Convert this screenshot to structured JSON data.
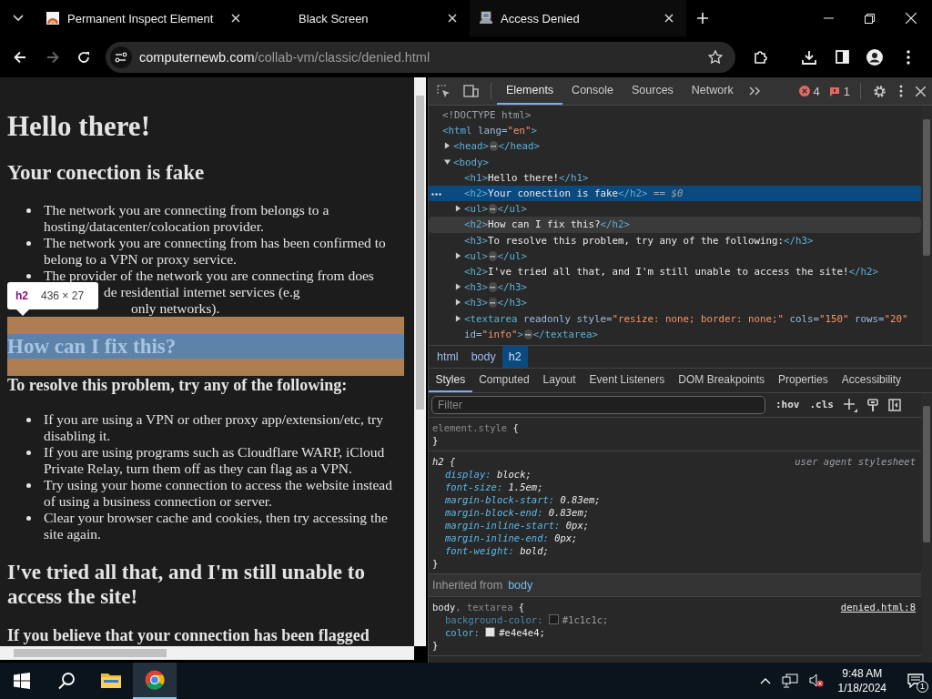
{
  "browser": {
    "tabs": [
      {
        "title": "Permanent Inspect Element",
        "kind": "image",
        "selected": false
      },
      {
        "title": "Black Screen",
        "kind": "blank",
        "selected": false
      },
      {
        "title": "Access Denied",
        "kind": "computer",
        "selected": true
      }
    ],
    "forward_disabled": true,
    "url": {
      "host": "computernewb.com",
      "path": "/collab-vm/classic/denied.html"
    }
  },
  "page": {
    "blocks": [
      {
        "kind": "h1",
        "text": "Hello there!",
        "highlighted": false
      },
      {
        "kind": "h2",
        "text": "Your conection is fake",
        "highlighted": false
      },
      {
        "kind": "ul",
        "items": [
          {
            "text": "The network you are connecting from belongs to a hosting/datacenter/colocation provider."
          },
          {
            "text": "The network you are connecting from has been confirmed to belong to a VPN or proxy service."
          },
          {
            "lines": [
              "The provider of the network you are connecting from does",
              "de residential internet services (e.g",
              "only networks)."
            ]
          }
        ]
      },
      {
        "kind": "h2",
        "text": "How can I fix this?",
        "highlighted": true
      },
      {
        "kind": "h3",
        "text": "To resolve this problem, try any of the following:",
        "highlighted": false
      },
      {
        "kind": "ul",
        "items": [
          {
            "text": "If you are using a VPN or other proxy app/extension/etc, try disabling it."
          },
          {
            "text": "If you are using programs such as Cloudflare WARP, iCloud Private Relay, turn them off as they can flag as a VPN."
          },
          {
            "text": "Try using your home connection to access the website instead of using a business connection or server."
          },
          {
            "text": "Clear your browser cache and cookies, then try accessing the site again."
          }
        ]
      },
      {
        "kind": "h2",
        "text": "I've tried all that, and I'm still unable to access the site!",
        "highlighted": false
      },
      {
        "kind": "h3",
        "text": "If you believe that your connection has been flagged",
        "highlighted": false
      }
    ],
    "tooltip": {
      "tag": "h2",
      "size": "436 × 27"
    }
  },
  "devtools": {
    "tabs": [
      {
        "label": "Elements",
        "selected": true
      },
      {
        "label": "Console",
        "selected": false
      },
      {
        "label": "Sources",
        "selected": false
      },
      {
        "label": "Network",
        "selected": false
      }
    ],
    "errors": "4",
    "issues": "1",
    "dom": [
      {
        "selected": false,
        "hovered": false,
        "tokens": [
          {
            "kind": "dim",
            "text": "<!DOCTYPE html>"
          }
        ]
      },
      {
        "selected": false,
        "hovered": false,
        "tokens": [
          {
            "kind": "tag",
            "text": "<html "
          },
          {
            "kind": "attr",
            "text": "lang="
          },
          {
            "kind": "value",
            "text": "\"en\""
          },
          {
            "kind": "tag",
            "text": ">"
          }
        ],
        "children": [
          {
            "selected": false,
            "hovered": false,
            "expanded": false,
            "tokens": [
              {
                "kind": "tag",
                "text": "<head>"
              },
              {
                "kind": "more",
                "text": "⋯"
              },
              {
                "kind": "tag",
                "text": "</head>"
              }
            ]
          },
          {
            "selected": false,
            "hovered": false,
            "expanded": true,
            "tokens": [
              {
                "kind": "tag",
                "text": "<body>"
              }
            ],
            "children": [
              {
                "selected": false,
                "hovered": false,
                "tokens": [
                  {
                    "kind": "tag",
                    "text": "<h1>"
                  },
                  {
                    "kind": "text",
                    "text": "Hello there!"
                  },
                  {
                    "kind": "tag",
                    "text": "</h1>"
                  }
                ]
              },
              {
                "selected": true,
                "hovered": false,
                "tokens": [
                  {
                    "kind": "tag",
                    "text": "<h2>"
                  },
                  {
                    "kind": "text",
                    "text": "Your conection is fake"
                  },
                  {
                    "kind": "tag",
                    "text": "</h2>"
                  },
                  {
                    "kind": "ref",
                    "text": " == $0"
                  }
                ]
              },
              {
                "selected": false,
                "hovered": false,
                "expanded": false,
                "tokens": [
                  {
                    "kind": "tag",
                    "text": "<ul>"
                  },
                  {
                    "kind": "more",
                    "text": "⋯"
                  },
                  {
                    "kind": "tag",
                    "text": "</ul>"
                  }
                ]
              },
              {
                "selected": false,
                "hovered": true,
                "tokens": [
                  {
                    "kind": "tag",
                    "text": "<h2>"
                  },
                  {
                    "kind": "text",
                    "text": "How can I fix this?"
                  },
                  {
                    "kind": "tag",
                    "text": "</h2>"
                  }
                ]
              },
              {
                "selected": false,
                "hovered": false,
                "tokens": [
                  {
                    "kind": "tag",
                    "text": "<h3>"
                  },
                  {
                    "kind": "text",
                    "text": "To resolve this problem, try any of the following:"
                  },
                  {
                    "kind": "tag",
                    "text": "</h3>"
                  }
                ]
              },
              {
                "selected": false,
                "hovered": false,
                "expanded": false,
                "tokens": [
                  {
                    "kind": "tag",
                    "text": "<ul>"
                  },
                  {
                    "kind": "more",
                    "text": "⋯"
                  },
                  {
                    "kind": "tag",
                    "text": "</ul>"
                  }
                ]
              },
              {
                "selected": false,
                "hovered": false,
                "tokens": [
                  {
                    "kind": "tag",
                    "text": "<h2>"
                  },
                  {
                    "kind": "text",
                    "text": "I've tried all that, and I'm still unable to access the site!"
                  },
                  {
                    "kind": "tag",
                    "text": "</h2>"
                  }
                ]
              },
              {
                "selected": false,
                "hovered": false,
                "expanded": false,
                "tokens": [
                  {
                    "kind": "tag",
                    "text": "<h3>"
                  },
                  {
                    "kind": "more",
                    "text": "⋯"
                  },
                  {
                    "kind": "tag",
                    "text": "</h3>"
                  }
                ]
              },
              {
                "selected": false,
                "hovered": false,
                "expanded": false,
                "tokens": [
                  {
                    "kind": "tag",
                    "text": "<h3>"
                  },
                  {
                    "kind": "more",
                    "text": "⋯"
                  },
                  {
                    "kind": "tag",
                    "text": "</h3>"
                  }
                ]
              },
              {
                "selected": false,
                "hovered": false,
                "expanded": false,
                "tokens": [
                  {
                    "kind": "tag",
                    "text": "<textarea "
                  },
                  {
                    "kind": "attr",
                    "text": "readonly style="
                  },
                  {
                    "kind": "value",
                    "text": "\"resize: none; border: none;\""
                  },
                  {
                    "kind": "attr",
                    "text": " cols="
                  },
                  {
                    "kind": "value",
                    "text": "\"150\""
                  },
                  {
                    "kind": "attr",
                    "text": " rows="
                  },
                  {
                    "kind": "value",
                    "text": "\"20\""
                  },
                  {
                    "kind": "attr",
                    "text": " id="
                  },
                  {
                    "kind": "value",
                    "text": "\"info\""
                  },
                  {
                    "kind": "tag",
                    "text": ">"
                  },
                  {
                    "kind": "more",
                    "text": "⋯"
                  },
                  {
                    "kind": "tag",
                    "text": "</textarea>"
                  }
                ]
              }
            ]
          }
        ]
      }
    ],
    "breadcrumbs": [
      {
        "label": "html",
        "selected": false
      },
      {
        "label": "body",
        "selected": false
      },
      {
        "label": "h2",
        "selected": true
      }
    ],
    "panes": [
      {
        "label": "Styles",
        "selected": true
      },
      {
        "label": "Computed",
        "selected": false
      },
      {
        "label": "Layout",
        "selected": false
      },
      {
        "label": "Event Listeners",
        "selected": false
      },
      {
        "label": "DOM Breakpoints",
        "selected": false
      },
      {
        "label": "Properties",
        "selected": false
      },
      {
        "label": "Accessibility",
        "selected": false
      }
    ],
    "filter": {
      "placeholder": "Filter"
    },
    "hov": ":hov",
    "cls": ".cls",
    "rules": [
      {
        "kind": "rule",
        "italic": false,
        "selector": [
          {
            "kind": "dim",
            "text": "element.style"
          },
          {
            "kind": "punc",
            "text": " {"
          }
        ],
        "close": "}"
      },
      {
        "kind": "rule",
        "italic": true,
        "selector": [
          {
            "kind": "sel",
            "text": "h2"
          },
          {
            "kind": "punc",
            "text": " {"
          }
        ],
        "source": "user agent stylesheet",
        "props": [
          {
            "name": "display:",
            "value": "block;",
            "inactive": false
          },
          {
            "name": "font-size:",
            "value": "1.5em;",
            "inactive": false
          },
          {
            "name": "margin-block-start:",
            "value": "0.83em;",
            "inactive": false
          },
          {
            "name": "margin-block-end:",
            "value": "0.83em;",
            "inactive": false
          },
          {
            "name": "margin-inline-start:",
            "value": "0px;",
            "inactive": false
          },
          {
            "name": "margin-inline-end:",
            "value": "0px;",
            "inactive": false
          },
          {
            "name": "font-weight:",
            "value": "bold;",
            "inactive": false
          }
        ],
        "close": "}"
      },
      {
        "kind": "inherited",
        "label": "Inherited from",
        "link": "body"
      },
      {
        "kind": "rule",
        "italic": false,
        "selector": [
          {
            "kind": "sel",
            "text": "body"
          },
          {
            "kind": "dim",
            "text": ", textarea"
          },
          {
            "kind": "punc",
            "text": " {"
          }
        ],
        "source": "denied.html:8",
        "props": [
          {
            "name": "background-color:",
            "value": "#1c1c1c;",
            "color": "#1c1c1c",
            "inactive": true
          },
          {
            "name": "color:",
            "value": "#e4e4e4;",
            "color": "#e4e4e4",
            "inactive": false
          }
        ],
        "close": "}"
      }
    ]
  },
  "taskbar": {
    "apps": [
      {
        "kind": "folder",
        "selected": false
      },
      {
        "kind": "chrome",
        "selected": true
      }
    ],
    "time": "9:48 AM",
    "date": "1/18/2024",
    "notifications": "1"
  }
}
